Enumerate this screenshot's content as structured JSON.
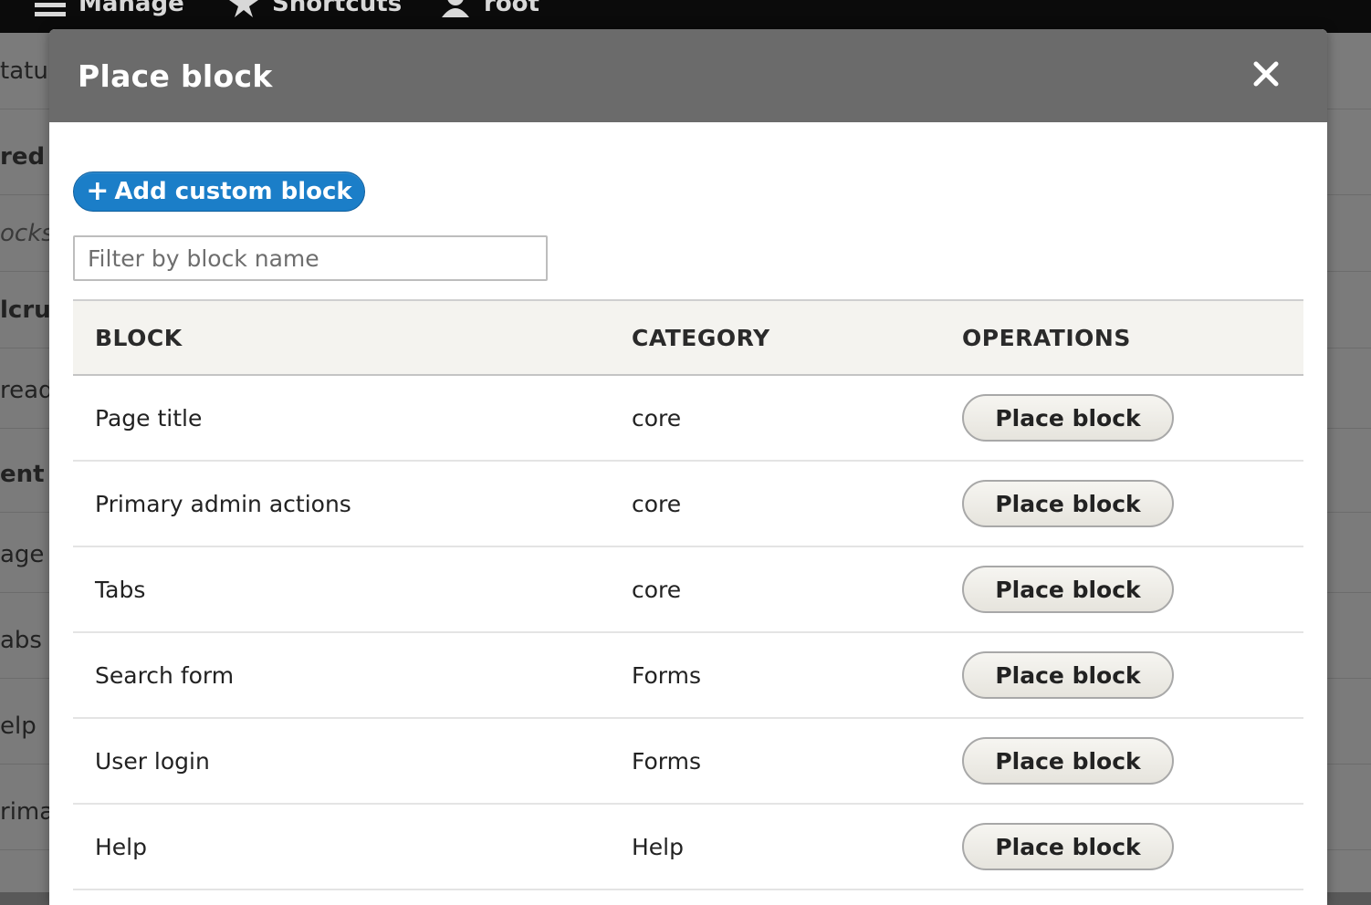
{
  "toolbar": {
    "items": [
      {
        "label": "Manage",
        "icon": "menu-icon"
      },
      {
        "label": "Shortcuts",
        "icon": "star-icon"
      },
      {
        "label": "root",
        "icon": "user-icon"
      }
    ]
  },
  "background_rows": [
    {
      "text": "tatus"
    },
    {
      "text": "red"
    },
    {
      "text": "ocks"
    },
    {
      "text": "lcrur"
    },
    {
      "text": "read"
    },
    {
      "text": "ent"
    },
    {
      "text": "age t"
    },
    {
      "text": "abs"
    },
    {
      "text": "elp"
    },
    {
      "text": "rima"
    }
  ],
  "dialog": {
    "title": "Place block",
    "close_icon": "close-icon",
    "add_button": {
      "plus": "+",
      "label": "Add custom block"
    },
    "filter": {
      "placeholder": "Filter by block name",
      "value": ""
    },
    "table": {
      "headers": {
        "block": "BLOCK",
        "category": "CATEGORY",
        "operations": "OPERATIONS"
      },
      "rows": [
        {
          "block": "Page title",
          "category": "core",
          "action": "Place block"
        },
        {
          "block": "Primary admin actions",
          "category": "core",
          "action": "Place block"
        },
        {
          "block": "Tabs",
          "category": "core",
          "action": "Place block"
        },
        {
          "block": "Search form",
          "category": "Forms",
          "action": "Place block"
        },
        {
          "block": "User login",
          "category": "Forms",
          "action": "Place block"
        },
        {
          "block": "Help",
          "category": "Help",
          "action": "Place block"
        }
      ]
    }
  },
  "colors": {
    "accent": "#1b7ec8",
    "header_bg": "#6b6b6b",
    "toolbar_bg": "#0b0b0b"
  }
}
